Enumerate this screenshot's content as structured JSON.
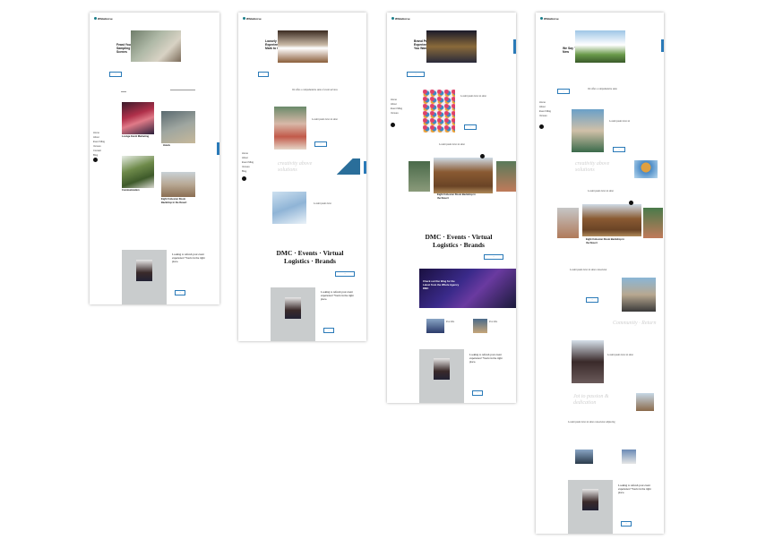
{
  "pages": [
    {
      "brand": "WhiteHorse",
      "hero_title": "Feast Your Eyes on a Sampling of the Scenes",
      "cards": [
        "Lounge Event Marketing",
        "Hotels",
        "Communication",
        "Eight Cohesion Room Backdrop in the Desert"
      ],
      "footer_text": "Looking to refresh your event experience? You're in the right place."
    },
    {
      "brand": "WhiteHorse",
      "hero_title": "Loosely Inbound Guests Experience The Atlantic Mark to Go",
      "ghost_text": "creativity above solutions",
      "tagline": "DMC · Events · Virtual Logistics · Brands",
      "footer_text": "Looking to refresh your event experience? You're in the right place."
    },
    {
      "brand": "WhiteHorse",
      "hero_title": "Brand Partners Know Experience Everywhere You Want to Be",
      "tagline": "DMC · Events · Virtual Logistics · Brands",
      "blog_title": "Check out Our Blog for the Latest from the Whole Agency DMC",
      "card_caption": "Eight Cohesion Room Backdrop in the Desert",
      "footer_text": "Looking to refresh your event experience? You're in the right place."
    },
    {
      "brand": "WhiteHorse",
      "hero_title": "We Say \"Yes!\" to New",
      "ghost_text_1": "creativity above solutions",
      "ghost_text_2": "Community · Return",
      "ghost_text_3": "Jot to passion & dedication",
      "card_caption": "Eight Cohesion Room Backdrop in the Desert",
      "footer_text": "Looking to refresh your event experience? You're in the right place."
    }
  ]
}
